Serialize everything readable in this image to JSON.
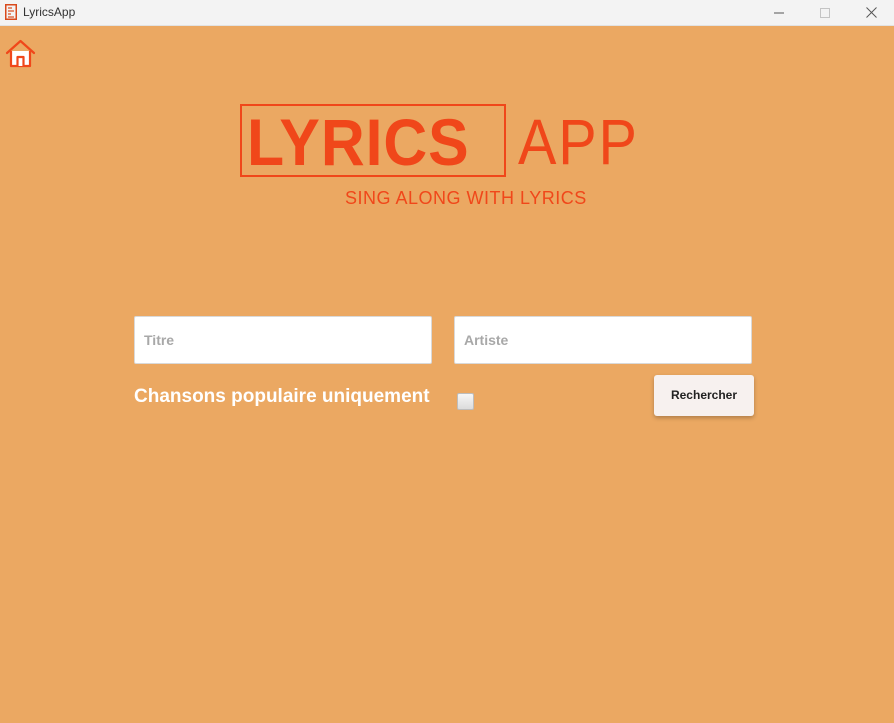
{
  "window": {
    "title": "LyricsApp",
    "icon": "lyrics-app-icon",
    "controls": [
      "minimize-icon",
      "maximize-icon",
      "close-icon"
    ]
  },
  "nav": {
    "home_icon": "home-icon"
  },
  "logo": {
    "word_bold": "LYRICS",
    "word_light": "APP",
    "tagline": "SING ALONG WITH LYRICS"
  },
  "search": {
    "title_placeholder": "Titre",
    "title_value": "",
    "artist_placeholder": "Artiste",
    "artist_value": "",
    "popular_label": "Chansons populaire uniquement",
    "popular_checked": false,
    "button_label": "Rechercher"
  },
  "colors": {
    "background": "#eba862",
    "accent": "#f0471a",
    "label": "#ffffff"
  }
}
